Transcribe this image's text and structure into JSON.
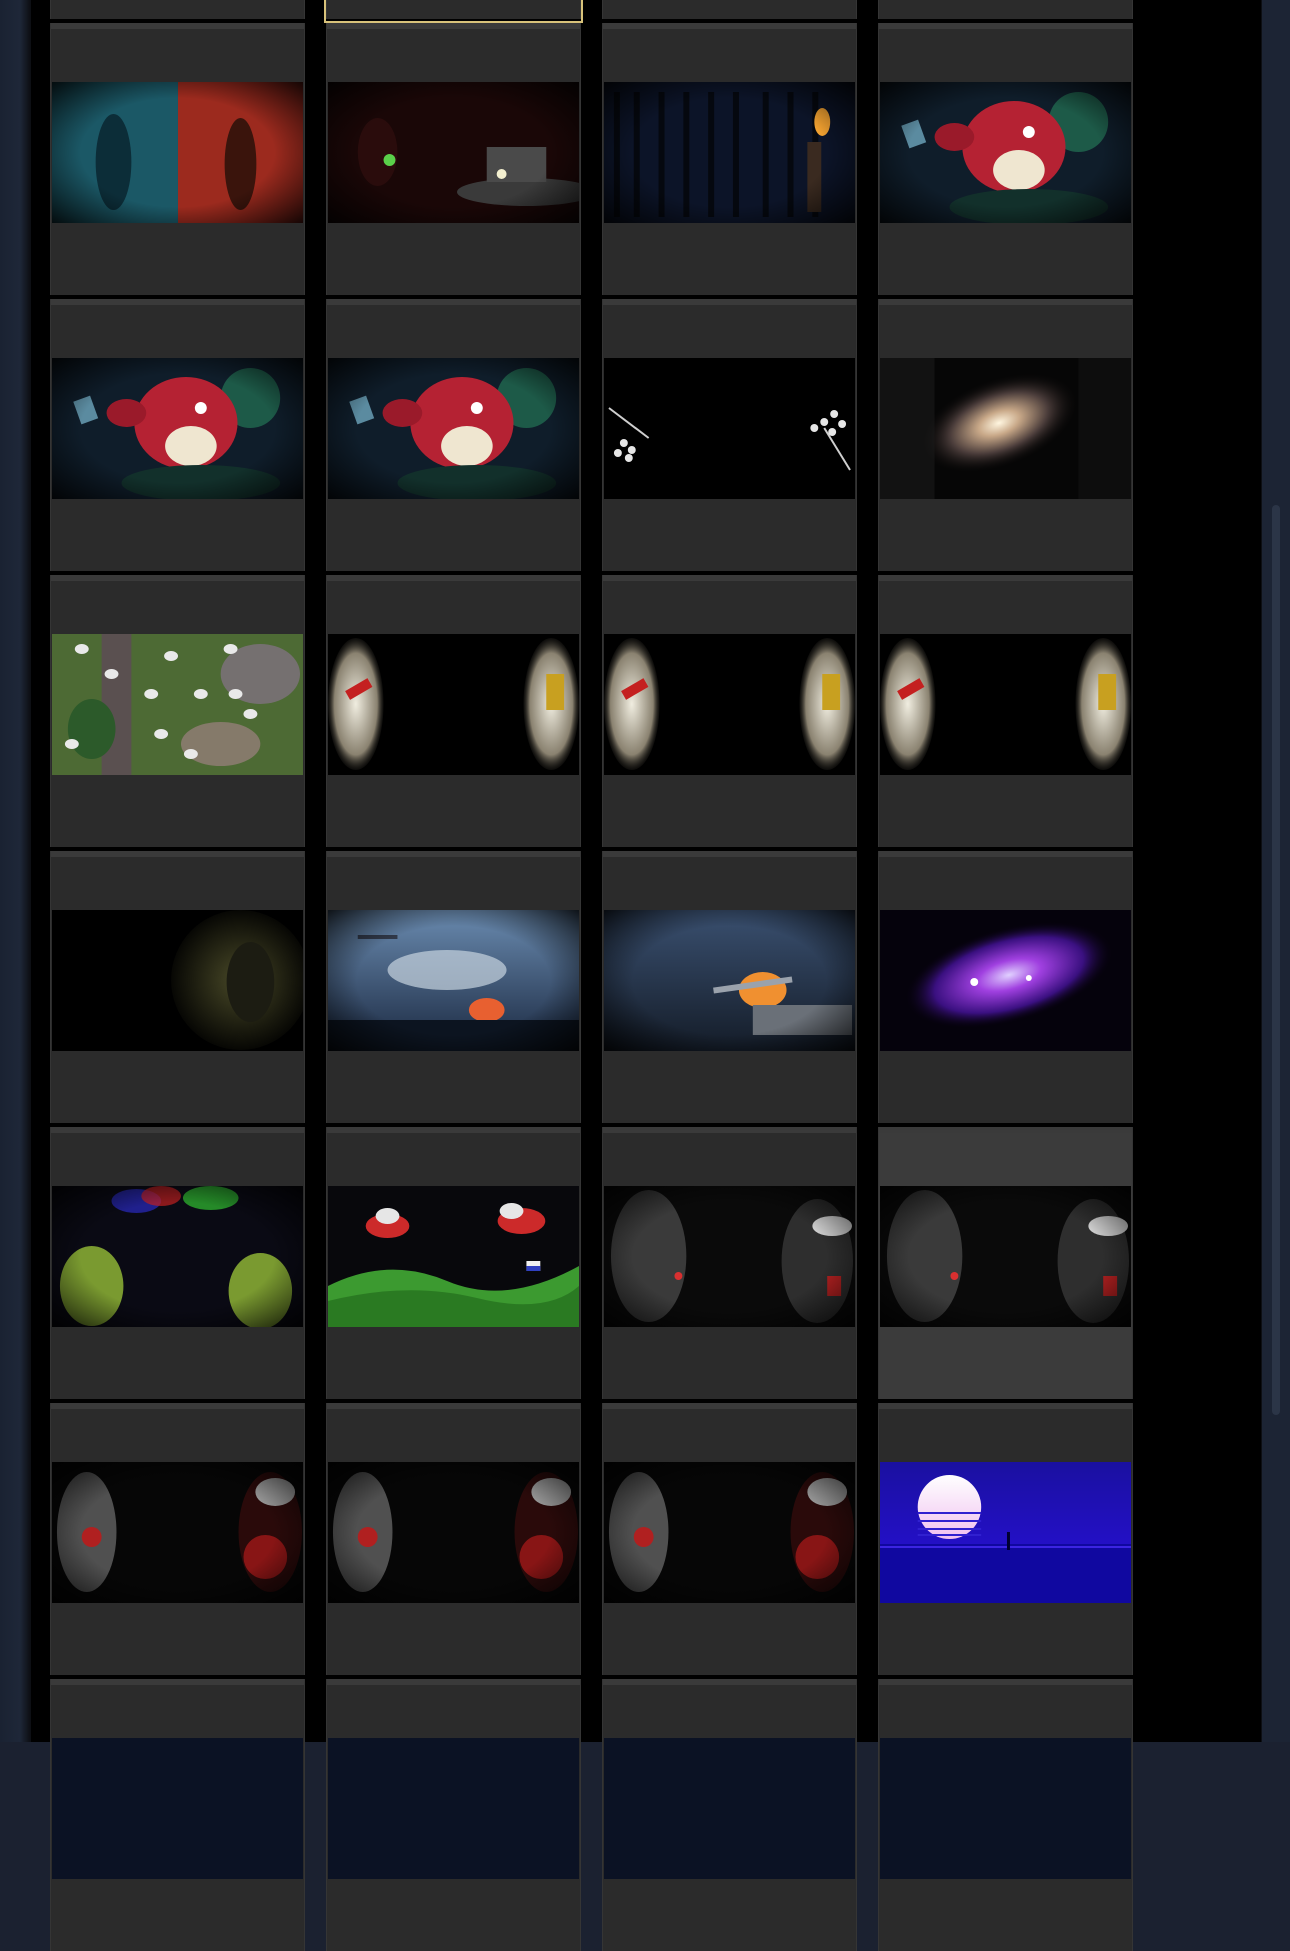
{
  "workshop_grid": {
    "columns": 4,
    "rows": [
      {
        "items": [
          {
            "id": "t0a",
            "label": "",
            "theme": "dark-blue"
          },
          {
            "id": "t0b",
            "label": "",
            "theme": "dark-blue",
            "selected": true
          },
          {
            "id": "t0c",
            "label": "",
            "theme": "dark-blue"
          },
          {
            "id": "t0d",
            "label": "",
            "theme": "dark-blue"
          }
        ]
      },
      {
        "items": [
          {
            "id": "t1a",
            "label": "",
            "theme": "blue-red-split"
          },
          {
            "id": "t1b",
            "label": "",
            "theme": "truck-night"
          },
          {
            "id": "t1c",
            "label": "",
            "theme": "forest-torch"
          },
          {
            "id": "t1d",
            "label": "",
            "theme": "red-monster"
          }
        ]
      },
      {
        "items": [
          {
            "id": "t2a",
            "label": "",
            "theme": "red-monster"
          },
          {
            "id": "t2b",
            "label": "",
            "theme": "red-monster"
          },
          {
            "id": "t2c",
            "label": "",
            "theme": "white-flowers"
          },
          {
            "id": "t2d",
            "label": "",
            "theme": "galaxy"
          }
        ]
      },
      {
        "items": [
          {
            "id": "t3a",
            "label": "",
            "theme": "green-map"
          },
          {
            "id": "t3b",
            "label": "",
            "theme": "vignette-sides"
          },
          {
            "id": "t3c",
            "label": "",
            "theme": "vignette-sides"
          },
          {
            "id": "t3d",
            "label": "",
            "theme": "vignette-sides"
          }
        ]
      },
      {
        "items": [
          {
            "id": "t4a",
            "label": "",
            "theme": "dark-soldier"
          },
          {
            "id": "t4b",
            "label": "",
            "theme": "sky-battle"
          },
          {
            "id": "t4c",
            "label": "",
            "theme": "naval-battle"
          },
          {
            "id": "t4d",
            "label": "",
            "theme": "purple-nebula"
          }
        ]
      },
      {
        "items": [
          {
            "id": "t5a",
            "label": "",
            "theme": "green-bugs"
          },
          {
            "id": "t5b",
            "label": "",
            "theme": "green-hills-planes"
          },
          {
            "id": "t5c",
            "label": "",
            "theme": "bw-soldiers"
          },
          {
            "id": "t5d",
            "label": "",
            "theme": "bw-soldiers",
            "hovered": true
          }
        ]
      },
      {
        "items": [
          {
            "id": "t6a",
            "label": "",
            "theme": "astronaut-red"
          },
          {
            "id": "t6b",
            "label": "",
            "theme": "astronaut-red"
          },
          {
            "id": "t6c",
            "label": "",
            "theme": "astronaut-red"
          },
          {
            "id": "t6d",
            "label": "",
            "theme": "synthwave-sunset"
          }
        ]
      },
      {
        "items": [
          {
            "id": "t7a",
            "label": "",
            "theme": "dark-blue"
          },
          {
            "id": "t7b",
            "label": "",
            "theme": "dark-blue"
          },
          {
            "id": "t7c",
            "label": "",
            "theme": "dark-blue"
          },
          {
            "id": "t7d",
            "label": "",
            "theme": "dark-blue"
          }
        ]
      }
    ]
  },
  "colors": {
    "panel_bg": "#000000",
    "cell_bg": "#2b2b2b",
    "cell_hover_bg": "#3b3b3b",
    "selection_outline": "#d8c27a",
    "sidebar_bg": "#1c2434"
  }
}
